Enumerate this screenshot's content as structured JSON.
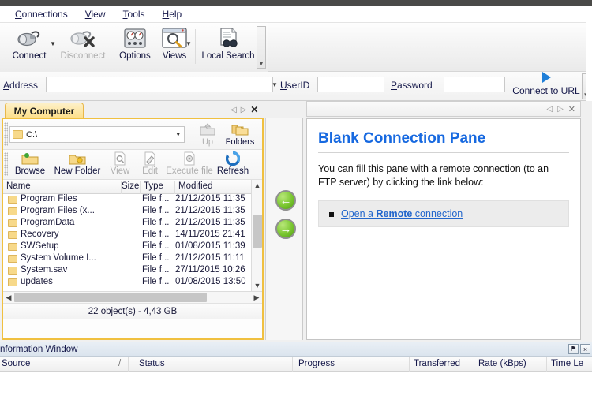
{
  "menu": {
    "items": [
      {
        "label": "Connections",
        "accel": "C"
      },
      {
        "label": "View",
        "accel": "V"
      },
      {
        "label": "Tools",
        "accel": "T"
      },
      {
        "label": "Help",
        "accel": "H"
      }
    ]
  },
  "ribbon": {
    "buttons": [
      {
        "label": "Connect",
        "icon": "plug-icon",
        "disabled": false,
        "split": true
      },
      {
        "label": "Disconnect",
        "icon": "plug-disconnect-icon",
        "disabled": true,
        "split": false
      },
      {
        "label": "Options",
        "icon": "gauges-icon",
        "disabled": false,
        "split": false
      },
      {
        "label": "Views",
        "icon": "window-magnifier-icon",
        "disabled": false,
        "split": true
      },
      {
        "label": "Local Search",
        "icon": "document-binoculars-icon",
        "disabled": false,
        "split": false
      }
    ]
  },
  "address": {
    "label": "Address",
    "accel": "A",
    "value": "",
    "userid_label": "UserID",
    "userid_accel": "U",
    "userid_value": "",
    "password_label": "Password",
    "password_accel": "P",
    "password_value": "",
    "connect_button": "Connect to URL",
    "connect_icon": "play-triangle-icon"
  },
  "left_pane": {
    "tab_label": "My Computer",
    "tab_controls": {
      "prev": "◁",
      "next": "▷",
      "close": "✕"
    },
    "path": {
      "value": "C:\\",
      "icon": "folder-icon",
      "chevron": "⌄"
    },
    "path_buttons": [
      {
        "label": "Up",
        "icon": "folder-up-icon",
        "disabled": true
      },
      {
        "label": "Folders",
        "icon": "folders-icon",
        "disabled": false
      }
    ],
    "action_buttons": [
      {
        "label": "Browse",
        "icon": "folder-browse-icon",
        "disabled": false
      },
      {
        "label": "New Folder",
        "icon": "folder-new-icon",
        "disabled": false
      },
      {
        "label": "View",
        "icon": "magnifier-doc-icon",
        "disabled": true
      },
      {
        "label": "Edit",
        "icon": "pencil-doc-icon",
        "disabled": true
      },
      {
        "label": "Execute file",
        "icon": "run-doc-icon",
        "disabled": true
      },
      {
        "label": "Refresh",
        "icon": "refresh-icon",
        "disabled": false
      }
    ],
    "columns": [
      "Name",
      "Size",
      "Type",
      "Modified"
    ],
    "rows": [
      {
        "name": "Program Files",
        "size": "",
        "type": "File f...",
        "modified": "21/12/2015 11:35"
      },
      {
        "name": "Program Files (x...",
        "size": "",
        "type": "File f...",
        "modified": "21/12/2015 11:35"
      },
      {
        "name": "ProgramData",
        "size": "",
        "type": "File f...",
        "modified": "21/12/2015 11:35"
      },
      {
        "name": "Recovery",
        "size": "",
        "type": "File f...",
        "modified": "14/11/2015 21:41"
      },
      {
        "name": "SWSetup",
        "size": "",
        "type": "File f...",
        "modified": "01/08/2015 11:39"
      },
      {
        "name": "System Volume I...",
        "size": "",
        "type": "File f...",
        "modified": "21/12/2015 11:11"
      },
      {
        "name": "System.sav",
        "size": "",
        "type": "File f...",
        "modified": "27/11/2015 10:26"
      },
      {
        "name": "updates",
        "size": "",
        "type": "File f...",
        "modified": "01/08/2015 13:50"
      }
    ],
    "status": "22 object(s) - 4,43 GB"
  },
  "transfer": {
    "left_arrow": "←",
    "right_arrow": "→"
  },
  "right_pane": {
    "tab_controls": {
      "prev": "◁",
      "next": "▷",
      "close": "✕"
    },
    "title": "Blank Connection Pane",
    "body_text": "You can fill this pane with a remote connection (to an FTP server) by clicking the link below:",
    "link_pre": "Open a ",
    "link_bold": "Remote",
    "link_post": " connection"
  },
  "info_window": {
    "title": "nformation Window",
    "pin_icon": "pin-icon",
    "close_icon": "close-icon",
    "pin_glyph": "⚑",
    "close_glyph": "×",
    "columns": [
      "Source",
      "Status",
      "Progress",
      "Transferred",
      "Rate (kBps)",
      "Time Le"
    ],
    "sort_indicator": "/"
  },
  "colors": {
    "tab_accent": "#f0c040",
    "link": "#2266cc",
    "title_blue": "#1769e0",
    "arrow_green": "#79c62f",
    "menu_text": "#15184a"
  }
}
